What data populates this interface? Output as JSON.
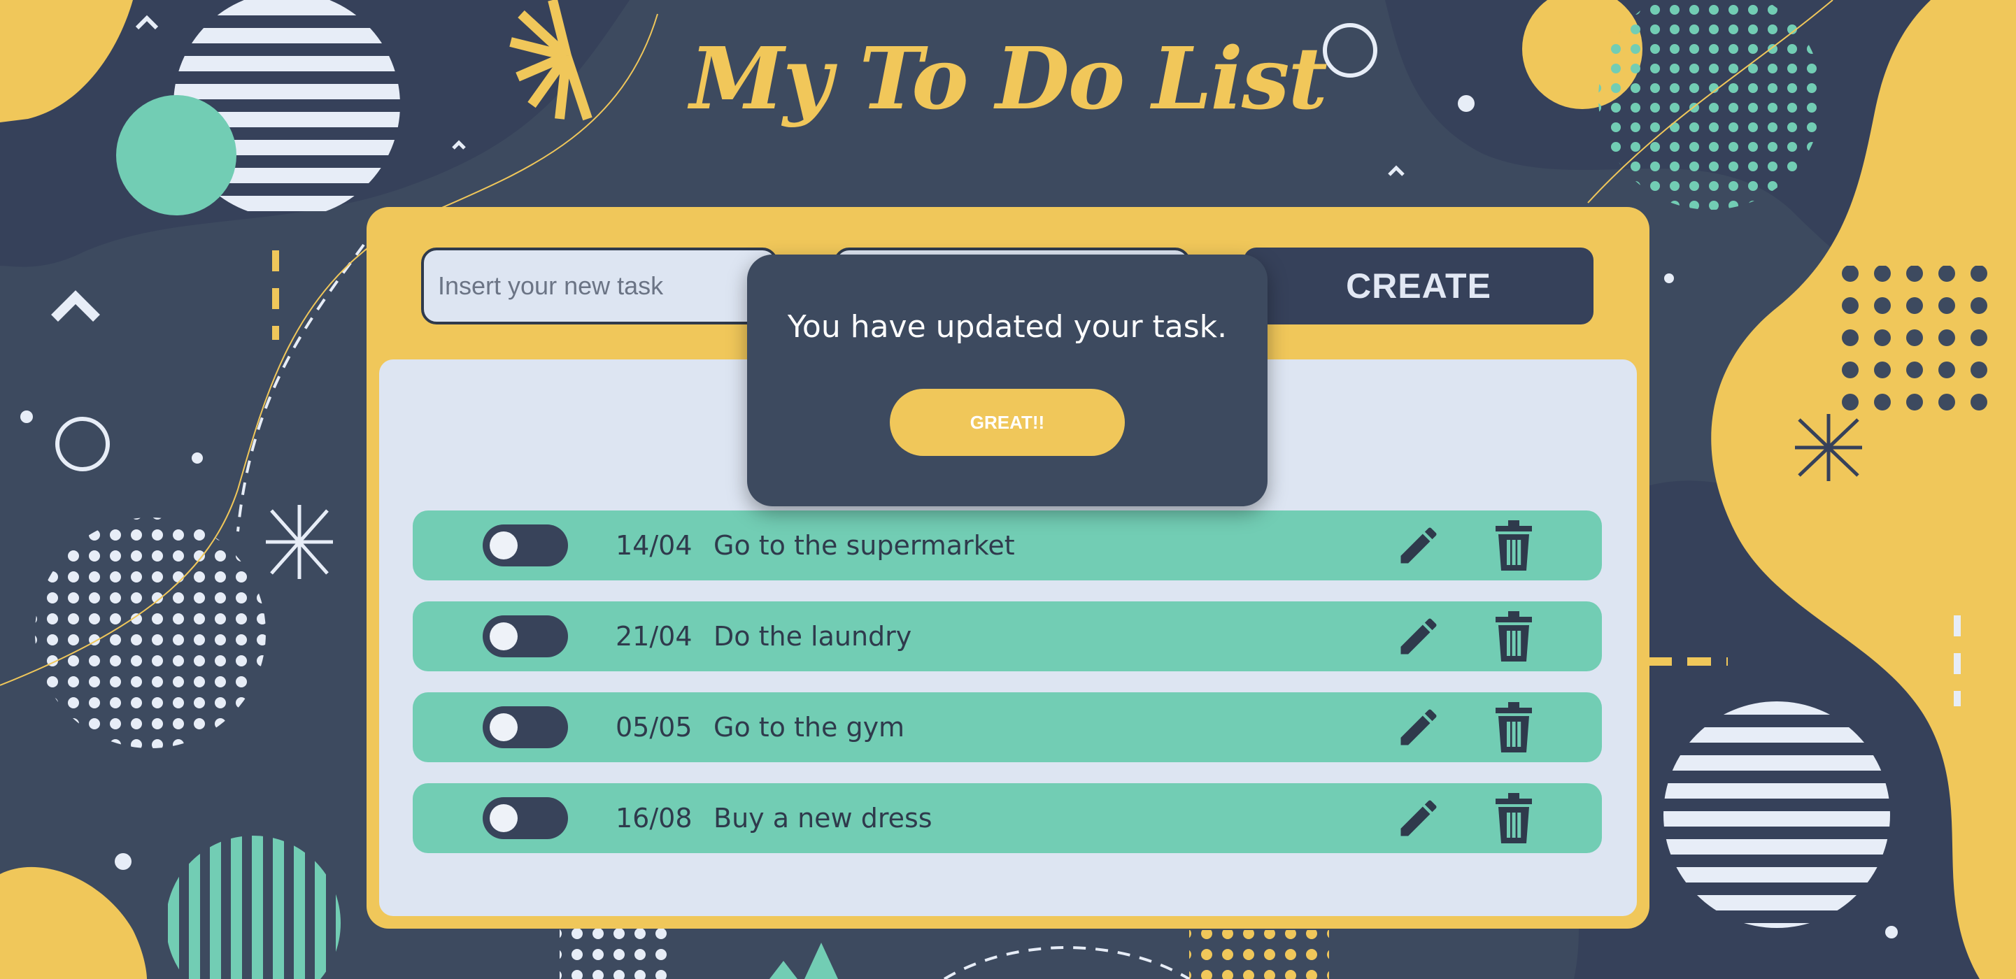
{
  "header": {
    "title": "My To Do List"
  },
  "form": {
    "task_placeholder": "Insert your new task",
    "task_value": "",
    "create_label": "CREATE"
  },
  "tasks": [
    {
      "date": "14/04",
      "text": "Go to the supermarket",
      "done": false
    },
    {
      "date": "21/04",
      "text": "Do the laundry",
      "done": false
    },
    {
      "date": "05/05",
      "text": "Go to the gym",
      "done": false
    },
    {
      "date": "16/08",
      "text": "Buy a new dress",
      "done": false
    }
  ],
  "modal": {
    "message": "You have updated your task.",
    "button_label": "GREAT!!"
  },
  "icons": {
    "edit": "pencil-icon",
    "delete": "trash-icon",
    "toggle": "toggle-switch"
  },
  "colors": {
    "background": "#3d4a5f",
    "accent_yellow": "#f0c75a",
    "teal": "#72cdb4",
    "panel": "#dde5f2",
    "dark": "#2f3a4c"
  }
}
